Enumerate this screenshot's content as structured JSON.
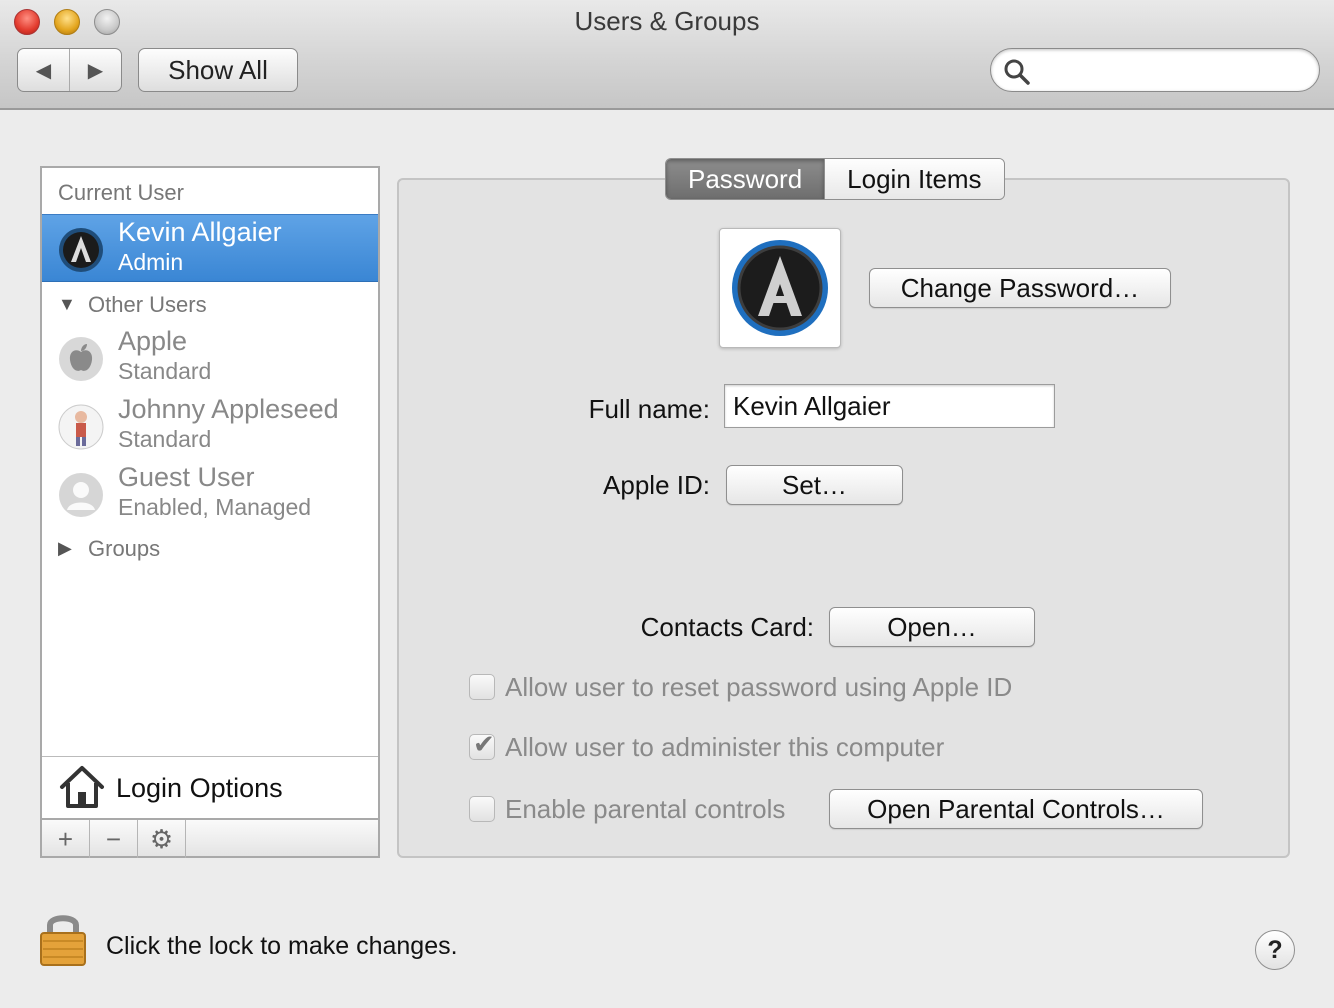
{
  "window": {
    "title": "Users & Groups"
  },
  "toolbar": {
    "back_label": "◀",
    "forward_label": "▶",
    "show_all_label": "Show All",
    "search_placeholder": ""
  },
  "sidebar": {
    "current_user_heading": "Current User",
    "current_user": {
      "name": "Kevin Allgaier",
      "role": "Admin"
    },
    "other_users_heading": "Other Users",
    "other_users": [
      {
        "name": "Apple",
        "role": "Standard"
      },
      {
        "name": "Johnny Appleseed",
        "role": "Standard"
      },
      {
        "name": "Guest User",
        "role": "Enabled, Managed"
      }
    ],
    "groups_heading": "Groups",
    "login_options_label": "Login Options",
    "add_label": "+",
    "remove_label": "−",
    "gear_label": "⚙"
  },
  "tabs": [
    {
      "label": "Password",
      "active": true
    },
    {
      "label": "Login Items",
      "active": false
    }
  ],
  "main": {
    "change_password_label": "Change Password…",
    "full_name_label": "Full name:",
    "full_name_value": "Kevin Allgaier",
    "apple_id_label": "Apple ID:",
    "apple_id_button": "Set…",
    "contacts_card_label": "Contacts Card:",
    "contacts_card_button": "Open…",
    "options": [
      {
        "label": "Allow user to reset password using Apple ID",
        "checked": false
      },
      {
        "label": "Allow user to administer this computer",
        "checked": true
      },
      {
        "label": "Enable parental controls",
        "checked": false
      }
    ],
    "parental_controls_button": "Open Parental Controls…"
  },
  "footer": {
    "lock_text": "Click the lock to make changes.",
    "help_label": "?"
  },
  "colors": {
    "selection": "#3a86d4",
    "window_bg": "#ececec",
    "active_tab": "#7a7a7a"
  }
}
